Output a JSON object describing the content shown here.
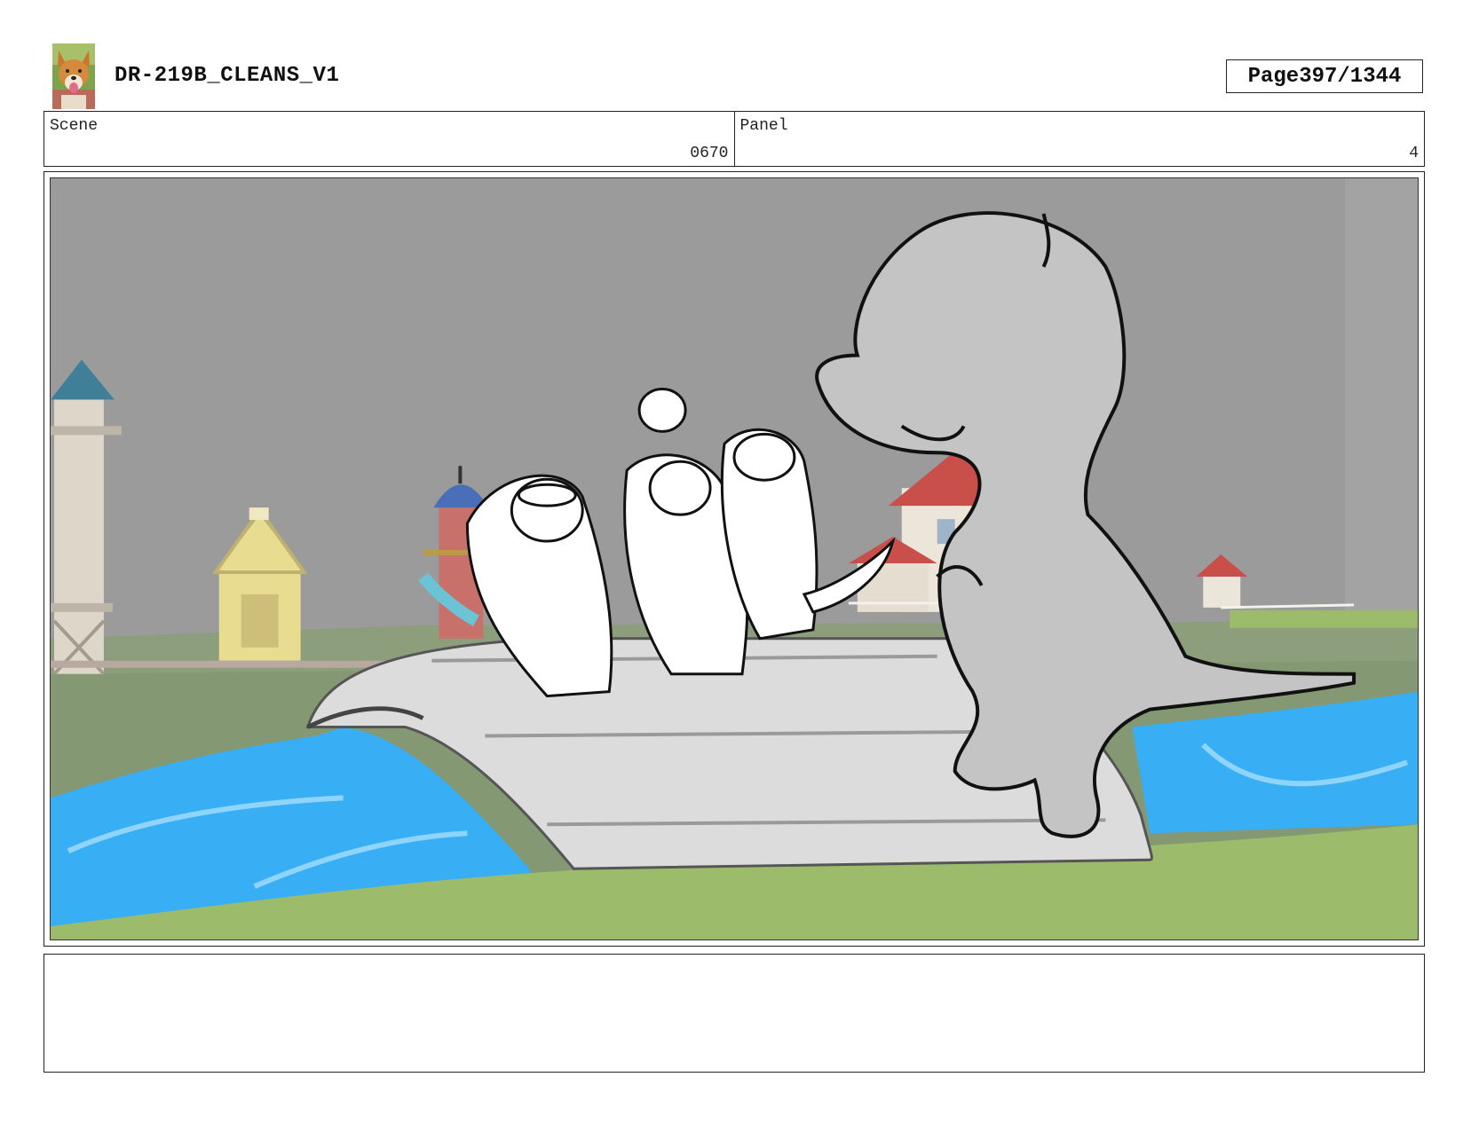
{
  "header": {
    "title": "DR-219B_CLEANS_V1",
    "page_label": "Page",
    "page_number": "397/1344"
  },
  "logo": {
    "icon": "dog-logo-icon"
  },
  "scene": {
    "label": "Scene",
    "value": "0670"
  },
  "panel": {
    "label": "Panel",
    "value": "4"
  },
  "notes": {
    "text": ""
  },
  "colors": {
    "sky": "#9b9b9b",
    "ground": "#8fa774",
    "water": "#38aef5",
    "bridge": "#dcdcdc",
    "dinosaur": "#c4c4c4"
  }
}
